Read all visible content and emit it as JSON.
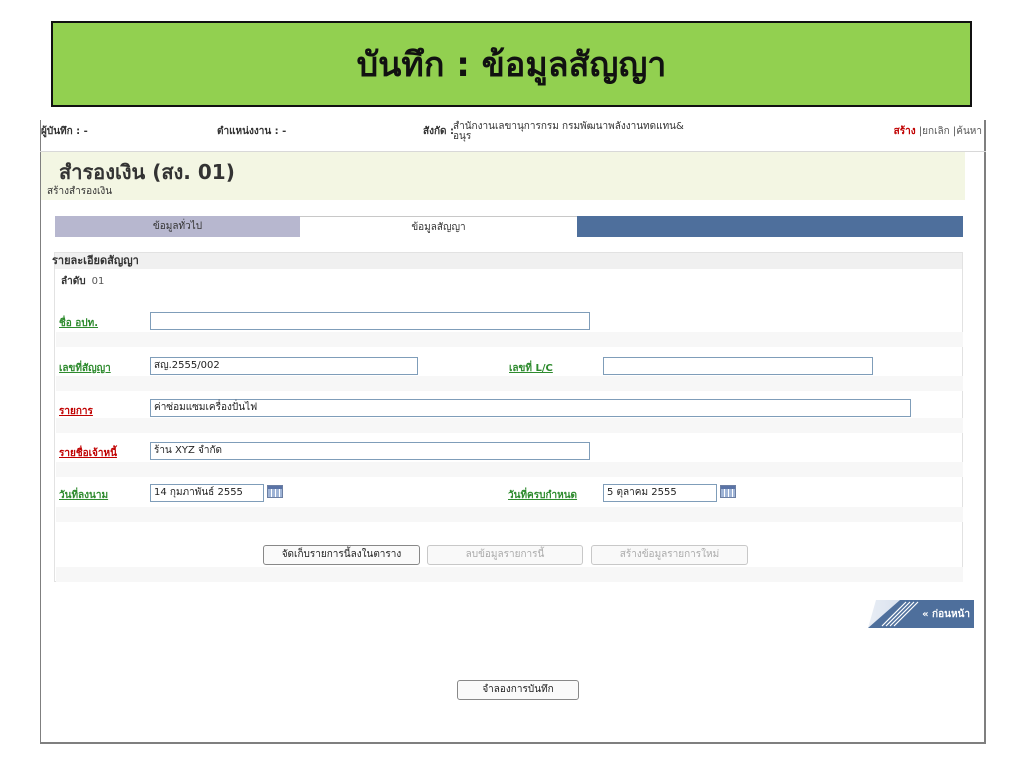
{
  "banner": {
    "title": "บันทึก : ข้อมูลสัญญา"
  },
  "topbar": {
    "recorder_label": "ผู้บันทึก : -",
    "position_label": "ตำแหน่งงาน : -",
    "org_label": "สังกัด :",
    "org_line1": "สำนักงานเลขานุการกรม กรมพัฒนาพลังงานทดแทน&",
    "org_line2": "อนุร",
    "create": "สร้าง",
    "cancel": "|ยกเลิก",
    "search": "|ค้นหา"
  },
  "header": {
    "title": "สำรองเงิน (สง. 01)",
    "subtitle": "สร้างสำรองเงิน"
  },
  "tabs": {
    "general": "ข้อมูลทั่วไป",
    "contract": "ข้อมูลสัญญา"
  },
  "section": {
    "title": "รายละเอียดสัญญา",
    "seq_label": "ลำดับ",
    "seq_value": "01"
  },
  "form": {
    "agency_label": "ชื่อ อปท.",
    "agency_value": "",
    "contract_no_label": "เลขที่สัญญา",
    "contract_no_value": "สญ.2555/002",
    "lc_label": "เลขที่ L/C",
    "lc_value": "",
    "item_label": "รายการ",
    "item_value": "ค่าซ่อมแซมเครื่องปั่นไฟ",
    "creditor_label": "รายชื่อเจ้าหนี้",
    "creditor_value": "ร้าน XYZ จำกัด",
    "sign_date_label": "วันที่ลงนาม",
    "sign_date_value": "14 กุมภาพันธ์ 2555",
    "due_date_label": "วันที่ครบกำหนด",
    "due_date_value": "5 ตุลาคม 2555"
  },
  "buttons": {
    "store": "จัดเก็บรายการนี้ลงในตาราง",
    "delete": "ลบข้อมูลรายการนี้",
    "new": "สร้างข้อมูลรายการใหม่",
    "prev": "« ก่อนหน้า",
    "simulate": "จำลองการบันทึก"
  },
  "colors": {
    "banner_bg": "#92d050",
    "tab_active_bg": "#b7b7cf",
    "tab_bar_bg": "#4e6f9c",
    "required_label": "#c00000",
    "optional_label": "#2e8b2e"
  }
}
